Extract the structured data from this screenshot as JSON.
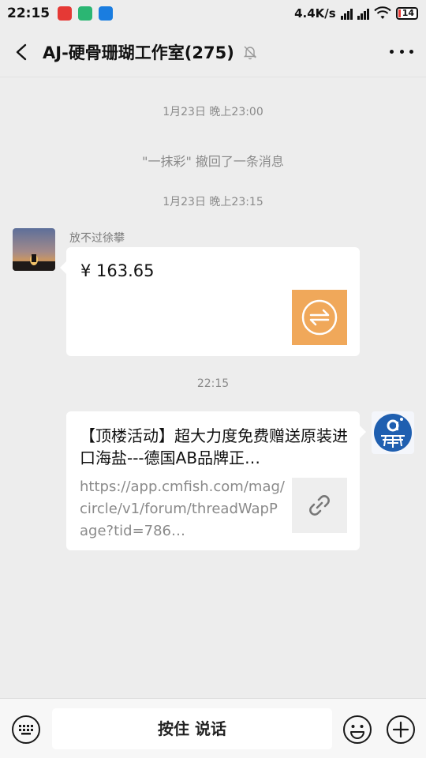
{
  "status_bar": {
    "time": "22:15",
    "network_speed": "4.4K/s",
    "battery": "14"
  },
  "header": {
    "title": "AJ-硬骨珊瑚工作室(275)"
  },
  "messages": [
    {
      "type": "timestamp",
      "text": "1月23日 晚上23:00"
    },
    {
      "type": "system",
      "text": "\"一抹彩\" 撤回了一条消息"
    },
    {
      "type": "timestamp",
      "text": "1月23日 晚上23:15"
    },
    {
      "type": "transfer",
      "sender": "放不过徐攀",
      "amount": "¥ 163.65"
    },
    {
      "type": "timestamp",
      "text": "22:15"
    },
    {
      "type": "link",
      "title": "【顶楼活动】超大力度免费赠送原装进口海盐---德国AB品牌正…",
      "description": "https://app.cmfish.com/mag/circle/v1/forum/threadWapPage?tid=786…"
    }
  ],
  "input_bar": {
    "talk_label": "按住 说话"
  },
  "colors": {
    "background": "#ededed",
    "transfer_accent": "#f0a85a",
    "avatar_blue": "#1f5fb0"
  }
}
